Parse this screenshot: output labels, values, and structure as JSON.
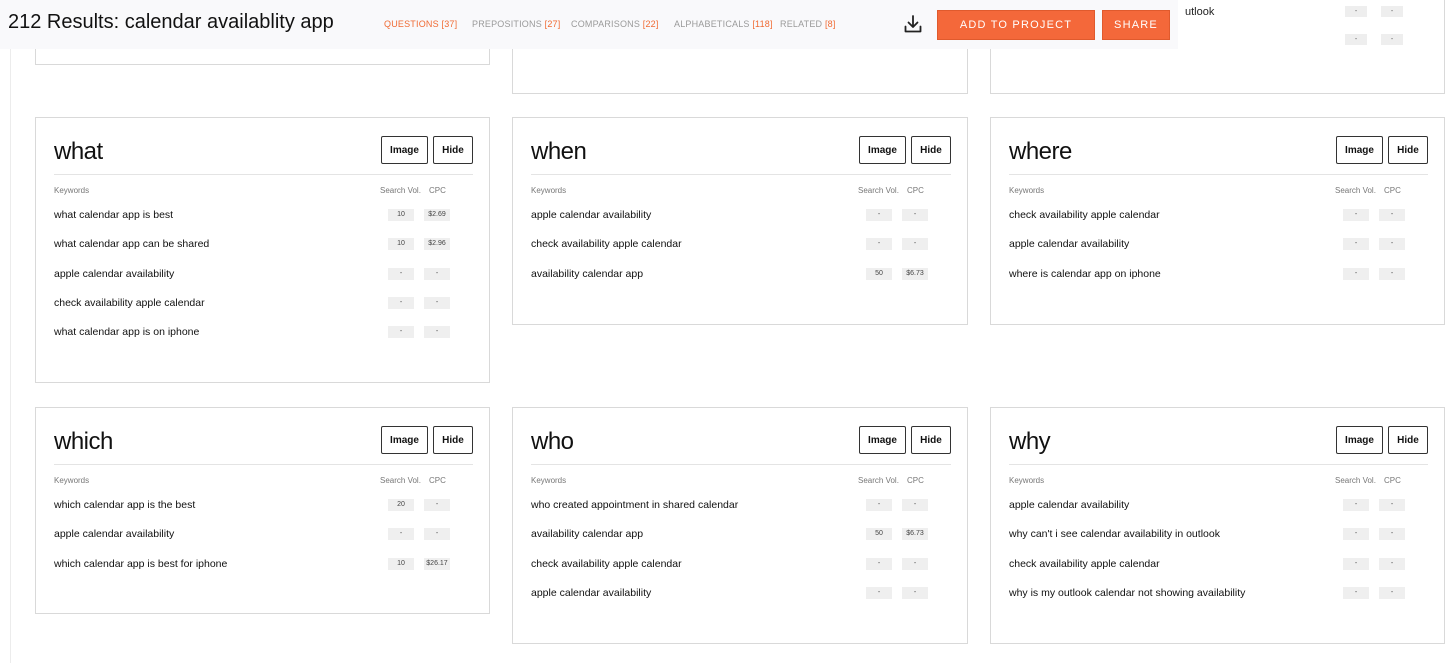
{
  "header": {
    "results_count": "212 Results:",
    "query": "calendar availablity app",
    "tabs": [
      {
        "label": "QUESTIONS",
        "count": "[37]",
        "active": true
      },
      {
        "label": "PREPOSITIONS",
        "count": "[27]",
        "active": false
      },
      {
        "label": "COMPARISONS",
        "count": "[22]",
        "active": false
      },
      {
        "label": "ALPHABETICALS",
        "count": "[118]",
        "active": false
      },
      {
        "label": "RELATED",
        "count": "[8]",
        "active": false
      }
    ],
    "download_icon": "download-icon",
    "add_to_project": "ADD TO PROJECT",
    "share": "SHARE"
  },
  "partial_top": {
    "right_card_text": "utlook",
    "dash": "-"
  },
  "column_labels": {
    "keywords": "Keywords",
    "search_vol": "Search Vol.",
    "cpc": "CPC"
  },
  "button_labels": {
    "image": "Image",
    "hide": "Hide"
  },
  "cards": [
    {
      "title": "what",
      "rows": [
        {
          "keyword": "what calendar app is best",
          "vol": "10",
          "cpc": "$2.69"
        },
        {
          "keyword": "what calendar app can be shared",
          "vol": "10",
          "cpc": "$2.96"
        },
        {
          "keyword": "apple calendar availability",
          "vol": "-",
          "cpc": "-"
        },
        {
          "keyword": "check availability apple calendar",
          "vol": "-",
          "cpc": "-"
        },
        {
          "keyword": "what calendar app is on iphone",
          "vol": "-",
          "cpc": "-"
        }
      ]
    },
    {
      "title": "when",
      "rows": [
        {
          "keyword": "apple calendar availability",
          "vol": "-",
          "cpc": "-"
        },
        {
          "keyword": "check availability apple calendar",
          "vol": "-",
          "cpc": "-"
        },
        {
          "keyword": "availability calendar app",
          "vol": "50",
          "cpc": "$6.73"
        }
      ]
    },
    {
      "title": "where",
      "rows": [
        {
          "keyword": "check availability apple calendar",
          "vol": "-",
          "cpc": "-"
        },
        {
          "keyword": "apple calendar availability",
          "vol": "-",
          "cpc": "-"
        },
        {
          "keyword": "where is calendar app on iphone",
          "vol": "-",
          "cpc": "-"
        }
      ]
    },
    {
      "title": "which",
      "rows": [
        {
          "keyword": "which calendar app is the best",
          "vol": "20",
          "cpc": "-"
        },
        {
          "keyword": "apple calendar availability",
          "vol": "-",
          "cpc": "-"
        },
        {
          "keyword": "which calendar app is best for iphone",
          "vol": "10",
          "cpc": "$26.17"
        }
      ]
    },
    {
      "title": "who",
      "rows": [
        {
          "keyword": "who created appointment in shared calendar",
          "vol": "-",
          "cpc": "-"
        },
        {
          "keyword": "availability calendar app",
          "vol": "50",
          "cpc": "$6.73"
        },
        {
          "keyword": "check availability apple calendar",
          "vol": "-",
          "cpc": "-"
        },
        {
          "keyword": "apple calendar availability",
          "vol": "-",
          "cpc": "-"
        }
      ]
    },
    {
      "title": "why",
      "rows": [
        {
          "keyword": "apple calendar availability",
          "vol": "-",
          "cpc": "-"
        },
        {
          "keyword": "why can't i see calendar availability in outlook",
          "vol": "-",
          "cpc": "-"
        },
        {
          "keyword": "check availability apple calendar",
          "vol": "-",
          "cpc": "-"
        },
        {
          "keyword": "why is my outlook calendar not showing availability",
          "vol": "-",
          "cpc": "-"
        }
      ]
    }
  ]
}
